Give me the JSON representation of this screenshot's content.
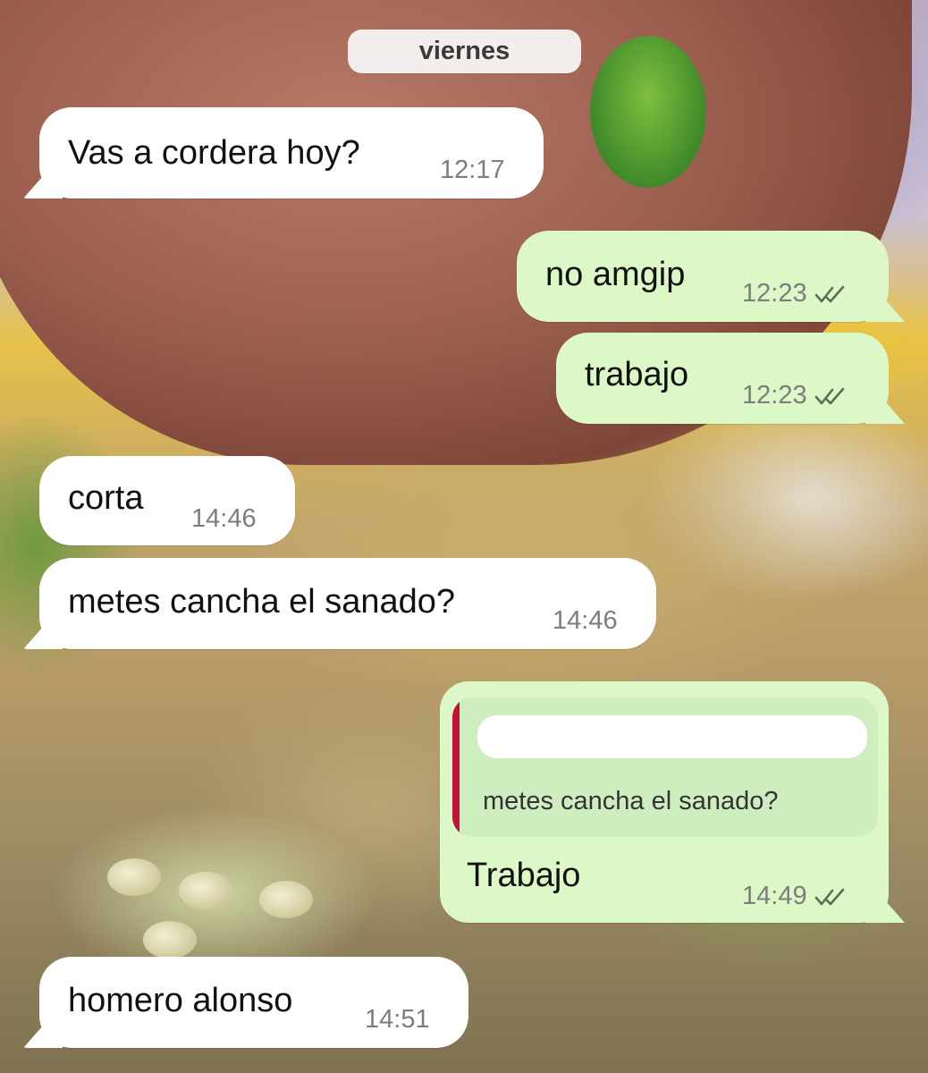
{
  "chat": {
    "date_label": "viernes",
    "messages": [
      {
        "direction": "in",
        "text": "Vas a cordera hoy?",
        "time": "12:17"
      },
      {
        "direction": "out",
        "text": "no amgip",
        "time": "12:23",
        "status": "read"
      },
      {
        "direction": "out",
        "text": "trabajo",
        "time": "12:23",
        "status": "read"
      },
      {
        "direction": "in",
        "text": "corta",
        "time": "14:46"
      },
      {
        "direction": "in",
        "text": "metes cancha el sanado?",
        "time": "14:46"
      },
      {
        "direction": "out",
        "text": "Trabajo",
        "time": "14:49",
        "status": "read",
        "reply_to": {
          "author": "",
          "text": "metes cancha el sanado?"
        }
      },
      {
        "direction": "in",
        "text": "homero alonso",
        "time": "14:51"
      }
    ]
  },
  "colors": {
    "incoming_bubble": "#ffffff",
    "outgoing_bubble": "#dcf8c6",
    "quote_bar": "#c3123a",
    "timestamp": "#7d7d7d",
    "date_pill": "#f6f3f3"
  },
  "icons": {
    "read_receipt": "double-check-icon"
  }
}
